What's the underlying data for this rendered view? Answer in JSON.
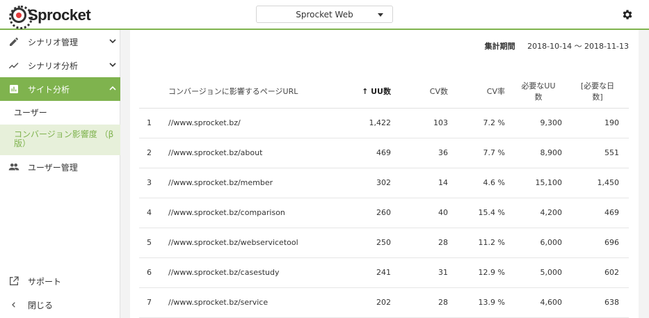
{
  "header": {
    "logo_text": "Sprocket",
    "project": "Sprocket Web",
    "settings_icon": "gear-icon"
  },
  "sidebar": {
    "items": [
      {
        "label": "シナリオ管理",
        "icon": "pencil-icon"
      },
      {
        "label": "シナリオ分析",
        "icon": "trend-line-icon"
      },
      {
        "label": "サイト分析",
        "icon": "bar-chart-icon"
      },
      {
        "label": "ユーザー管理",
        "icon": "people-icon"
      }
    ],
    "subitems": [
      {
        "label": "ユーザー"
      },
      {
        "label_line1": "コンバージョン影響度 （β",
        "label_line2": "版）"
      }
    ],
    "bottom": [
      {
        "label": "サポート",
        "icon": "external-link-icon"
      },
      {
        "label": "閉じる",
        "icon": "chevron-left-icon"
      }
    ]
  },
  "colors": {
    "accent": "#7fb34e",
    "accent_light": "#e7f0da"
  },
  "main": {
    "period_label": "集計期間",
    "period_value": "2018-10-14 ～ 2018-11-13",
    "table": {
      "headers": {
        "url": "コンバージョンに影響するページURL",
        "uu_arrow": "↑",
        "uu": "UU数",
        "cv": "CV数",
        "rate": "CV率",
        "need_uu_1": "必要なUU",
        "need_uu_2": "数",
        "need_days_1": "[必要な日",
        "need_days_2": "数]"
      },
      "rows": [
        {
          "idx": "1",
          "url": "//www.sprocket.bz/",
          "uu": "1,422",
          "cv": "103",
          "rate": "7.2 %",
          "need_uu": "9,300",
          "need_days": "190"
        },
        {
          "idx": "2",
          "url": "//www.sprocket.bz/about",
          "uu": "469",
          "cv": "36",
          "rate": "7.7 %",
          "need_uu": "8,900",
          "need_days": "551"
        },
        {
          "idx": "3",
          "url": "//www.sprocket.bz/member",
          "uu": "302",
          "cv": "14",
          "rate": "4.6 %",
          "need_uu": "15,100",
          "need_days": "1,450"
        },
        {
          "idx": "4",
          "url": "//www.sprocket.bz/comparison",
          "uu": "260",
          "cv": "40",
          "rate": "15.4 %",
          "need_uu": "4,200",
          "need_days": "469"
        },
        {
          "idx": "5",
          "url": "//www.sprocket.bz/webservicetool",
          "uu": "250",
          "cv": "28",
          "rate": "11.2 %",
          "need_uu": "6,000",
          "need_days": "696"
        },
        {
          "idx": "6",
          "url": "//www.sprocket.bz/casestudy",
          "uu": "241",
          "cv": "31",
          "rate": "12.9 %",
          "need_uu": "5,000",
          "need_days": "602"
        },
        {
          "idx": "7",
          "url": "//www.sprocket.bz/service",
          "uu": "202",
          "cv": "28",
          "rate": "13.9 %",
          "need_uu": "4,600",
          "need_days": "638"
        }
      ]
    }
  }
}
